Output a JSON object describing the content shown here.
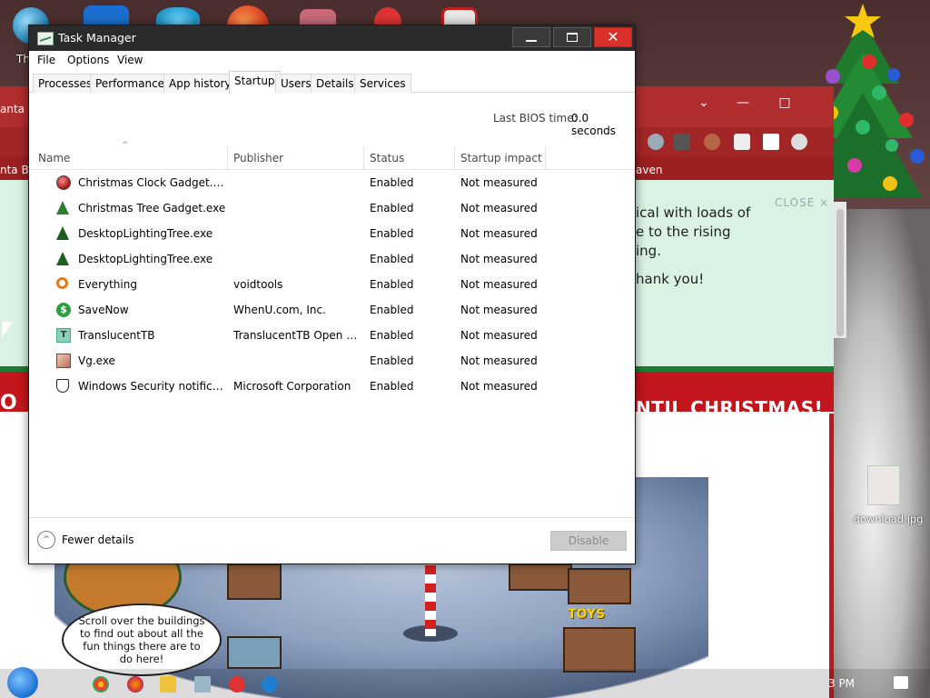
{
  "desktop": {
    "icon_label_partial": "Th",
    "download_label": "download.jpg"
  },
  "bg_browser": {
    "tab_text": "anta C",
    "nav_text": "nta Bo",
    "bookmark_raven": "aven",
    "notice_lines": [
      "ical with loads of",
      "e to the rising",
      "ing.",
      "hank you!"
    ],
    "close_label": "CLOSE ×",
    "countdown": "NTIL CHRISTMAS!",
    "countdown_left": "O",
    "speech": "Scroll over the buildings to find out about all the fun things there are to do here!",
    "toys_sign": "TOYS"
  },
  "taskbar": {
    "clock": "3 PM"
  },
  "task_manager": {
    "title": "Task Manager",
    "controls": {
      "minimize": "",
      "maximize": "",
      "close": "✕"
    },
    "menu": [
      "File",
      "Options",
      "View"
    ],
    "tabs": [
      {
        "label": "Processes",
        "active": false
      },
      {
        "label": "Performance",
        "active": false
      },
      {
        "label": "App history",
        "active": false
      },
      {
        "label": "Startup",
        "active": true
      },
      {
        "label": "Users",
        "active": false
      },
      {
        "label": "Details",
        "active": false
      },
      {
        "label": "Services",
        "active": false
      }
    ],
    "bios_label": "Last BIOS time:",
    "bios_value": "0.0 seconds",
    "columns": {
      "name": "Name",
      "publisher": "Publisher",
      "status": "Status",
      "impact": "Startup impact",
      "sort_indicator": "^"
    },
    "rows": [
      {
        "name": "Christmas Clock Gadget.exe",
        "publisher": "",
        "status": "Enabled",
        "impact": "Not measured",
        "icon": "ornament-icon"
      },
      {
        "name": "Christmas Tree Gadget.exe",
        "publisher": "",
        "status": "Enabled",
        "impact": "Not measured",
        "icon": "tree-icon"
      },
      {
        "name": "DesktopLightingTree.exe",
        "publisher": "",
        "status": "Enabled",
        "impact": "Not measured",
        "icon": "tree-icon"
      },
      {
        "name": "DesktopLightingTree.exe",
        "publisher": "",
        "status": "Enabled",
        "impact": "Not measured",
        "icon": "tree-icon"
      },
      {
        "name": "Everything",
        "publisher": "voidtools",
        "status": "Enabled",
        "impact": "Not measured",
        "icon": "search-icon"
      },
      {
        "name": "SaveNow",
        "publisher": "WhenU.com, Inc.",
        "status": "Enabled",
        "impact": "Not measured",
        "icon": "dollar-icon"
      },
      {
        "name": "TranslucentTB",
        "publisher": "TranslucentTB Open Sou...",
        "status": "Enabled",
        "impact": "Not measured",
        "icon": "translucenttb-icon"
      },
      {
        "name": "Vg.exe",
        "publisher": "",
        "status": "Enabled",
        "impact": "Not measured",
        "icon": "photo-icon"
      },
      {
        "name": "Windows Security notificati...",
        "publisher": "Microsoft Corporation",
        "status": "Enabled",
        "impact": "Not measured",
        "icon": "shield-icon"
      }
    ],
    "footer": {
      "fewer_details": "Fewer details",
      "disable": "Disable",
      "fewer_icon": "^"
    }
  }
}
